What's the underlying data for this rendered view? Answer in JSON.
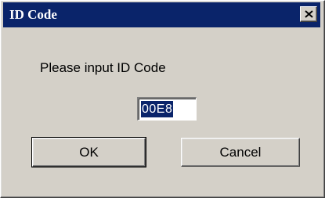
{
  "dialog": {
    "title": "ID Code",
    "close_symbol": "×",
    "prompt": "Please input ID Code",
    "id_value": "00E8",
    "ok_label": "OK",
    "cancel_label": "Cancel"
  },
  "colors": {
    "titlebar": "#0a246a",
    "face": "#d4d0c8",
    "selection": "#0a246a"
  },
  "icons": {
    "close": "close-icon"
  }
}
